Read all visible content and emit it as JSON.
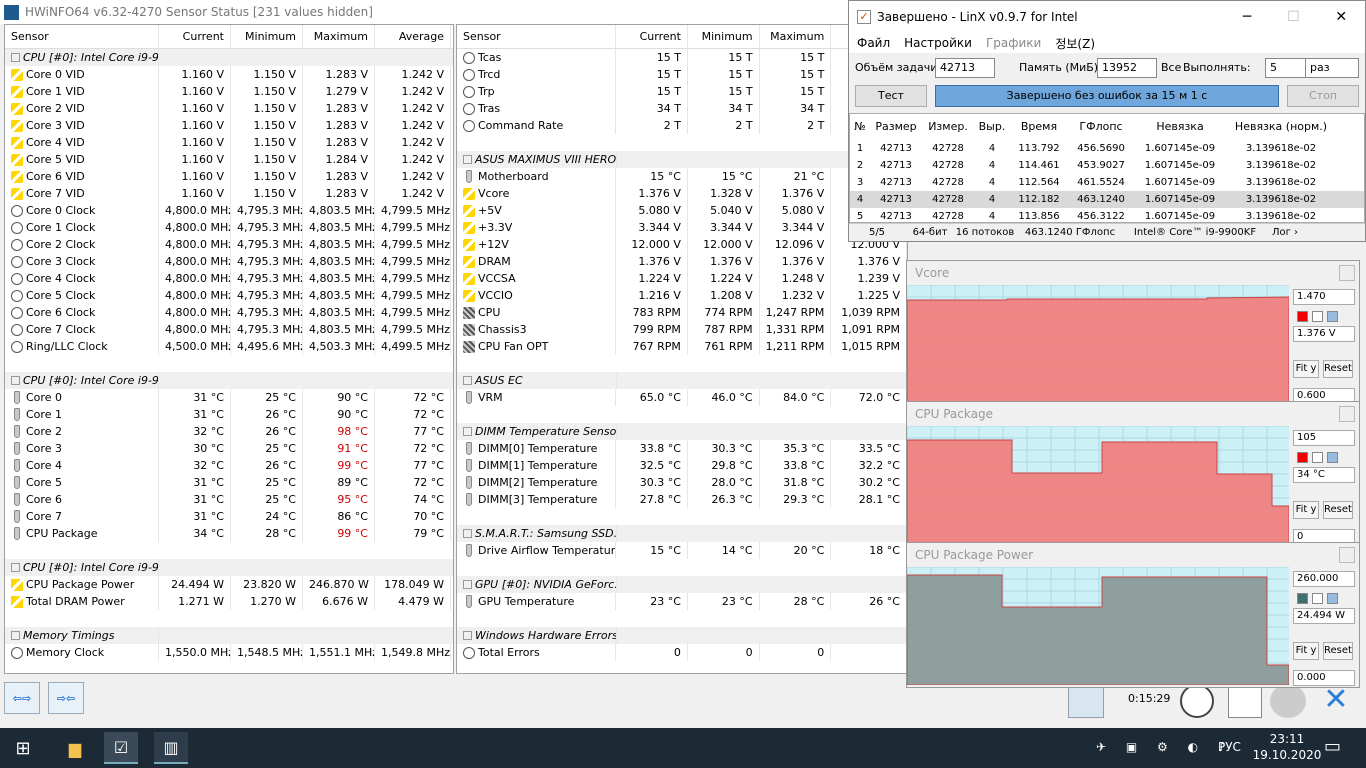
{
  "hwinfo": {
    "title": "HWiNFO64 v6.32-4270 Sensor Status [231 values hidden]",
    "headers": [
      "Sensor",
      "Current",
      "Minimum",
      "Maximum",
      "Average"
    ],
    "left": [
      {
        "t": "g",
        "n": "CPU [#0]: Intel Core i9-9..."
      },
      {
        "i": "volt",
        "n": "Core 0 VID",
        "c": "1.160 V",
        "mi": "1.150 V",
        "ma": "1.283 V",
        "a": "1.242 V"
      },
      {
        "i": "volt",
        "n": "Core 1 VID",
        "c": "1.160 V",
        "mi": "1.150 V",
        "ma": "1.279 V",
        "a": "1.242 V"
      },
      {
        "i": "volt",
        "n": "Core 2 VID",
        "c": "1.160 V",
        "mi": "1.150 V",
        "ma": "1.283 V",
        "a": "1.242 V"
      },
      {
        "i": "volt",
        "n": "Core 3 VID",
        "c": "1.160 V",
        "mi": "1.150 V",
        "ma": "1.283 V",
        "a": "1.242 V"
      },
      {
        "i": "volt",
        "n": "Core 4 VID",
        "c": "1.160 V",
        "mi": "1.150 V",
        "ma": "1.283 V",
        "a": "1.242 V"
      },
      {
        "i": "volt",
        "n": "Core 5 VID",
        "c": "1.160 V",
        "mi": "1.150 V",
        "ma": "1.284 V",
        "a": "1.242 V"
      },
      {
        "i": "volt",
        "n": "Core 6 VID",
        "c": "1.160 V",
        "mi": "1.150 V",
        "ma": "1.283 V",
        "a": "1.242 V"
      },
      {
        "i": "volt",
        "n": "Core 7 VID",
        "c": "1.160 V",
        "mi": "1.150 V",
        "ma": "1.283 V",
        "a": "1.242 V"
      },
      {
        "i": "clock",
        "n": "Core 0 Clock",
        "c": "4,800.0 MHz",
        "mi": "4,795.3 MHz",
        "ma": "4,803.5 MHz",
        "a": "4,799.5 MHz"
      },
      {
        "i": "clock",
        "n": "Core 1 Clock",
        "c": "4,800.0 MHz",
        "mi": "4,795.3 MHz",
        "ma": "4,803.5 MHz",
        "a": "4,799.5 MHz"
      },
      {
        "i": "clock",
        "n": "Core 2 Clock",
        "c": "4,800.0 MHz",
        "mi": "4,795.3 MHz",
        "ma": "4,803.5 MHz",
        "a": "4,799.5 MHz"
      },
      {
        "i": "clock",
        "n": "Core 3 Clock",
        "c": "4,800.0 MHz",
        "mi": "4,795.3 MHz",
        "ma": "4,803.5 MHz",
        "a": "4,799.5 MHz"
      },
      {
        "i": "clock",
        "n": "Core 4 Clock",
        "c": "4,800.0 MHz",
        "mi": "4,795.3 MHz",
        "ma": "4,803.5 MHz",
        "a": "4,799.5 MHz"
      },
      {
        "i": "clock",
        "n": "Core 5 Clock",
        "c": "4,800.0 MHz",
        "mi": "4,795.3 MHz",
        "ma": "4,803.5 MHz",
        "a": "4,799.5 MHz"
      },
      {
        "i": "clock",
        "n": "Core 6 Clock",
        "c": "4,800.0 MHz",
        "mi": "4,795.3 MHz",
        "ma": "4,803.5 MHz",
        "a": "4,799.5 MHz"
      },
      {
        "i": "clock",
        "n": "Core 7 Clock",
        "c": "4,800.0 MHz",
        "mi": "4,795.3 MHz",
        "ma": "4,803.5 MHz",
        "a": "4,799.5 MHz"
      },
      {
        "i": "clock",
        "n": "Ring/LLC Clock",
        "c": "4,500.0 MHz",
        "mi": "4,495.6 MHz",
        "ma": "4,503.3 MHz",
        "a": "4,499.5 MHz"
      },
      {
        "t": "b"
      },
      {
        "t": "g",
        "n": "CPU [#0]: Intel Core i9-9..."
      },
      {
        "i": "temp",
        "n": "Core 0",
        "c": "31 °C",
        "mi": "25 °C",
        "ma": "90 °C",
        "a": "72 °C"
      },
      {
        "i": "temp",
        "n": "Core 1",
        "c": "31 °C",
        "mi": "26 °C",
        "ma": "90 °C",
        "a": "72 °C"
      },
      {
        "i": "temp",
        "n": "Core 2",
        "c": "32 °C",
        "mi": "26 °C",
        "ma": "98 °C",
        "a": "77 °C",
        "r": 1
      },
      {
        "i": "temp",
        "n": "Core 3",
        "c": "30 °C",
        "mi": "25 °C",
        "ma": "91 °C",
        "a": "72 °C",
        "r": 1
      },
      {
        "i": "temp",
        "n": "Core 4",
        "c": "32 °C",
        "mi": "26 °C",
        "ma": "99 °C",
        "a": "77 °C",
        "r": 1
      },
      {
        "i": "temp",
        "n": "Core 5",
        "c": "31 °C",
        "mi": "25 °C",
        "ma": "89 °C",
        "a": "72 °C"
      },
      {
        "i": "temp",
        "n": "Core 6",
        "c": "31 °C",
        "mi": "25 °C",
        "ma": "95 °C",
        "a": "74 °C",
        "r": 1
      },
      {
        "i": "temp",
        "n": "Core 7",
        "c": "31 °C",
        "mi": "24 °C",
        "ma": "86 °C",
        "a": "70 °C"
      },
      {
        "i": "temp",
        "n": "CPU Package",
        "c": "34 °C",
        "mi": "28 °C",
        "ma": "99 °C",
        "a": "79 °C",
        "r": 1
      },
      {
        "t": "b"
      },
      {
        "t": "g",
        "n": "CPU [#0]: Intel Core i9-9..."
      },
      {
        "i": "pow",
        "n": "CPU Package Power",
        "c": "24.494 W",
        "mi": "23.820 W",
        "ma": "246.870 W",
        "a": "178.049 W"
      },
      {
        "i": "pow",
        "n": "Total DRAM Power",
        "c": "1.271 W",
        "mi": "1.270 W",
        "ma": "6.676 W",
        "a": "4.479 W"
      },
      {
        "t": "b"
      },
      {
        "t": "g",
        "n": "Memory Timings"
      },
      {
        "i": "clock",
        "n": "Memory Clock",
        "c": "1,550.0 MHz",
        "mi": "1,548.5 MHz",
        "ma": "1,551.1 MHz",
        "a": "1,549.8 MHz"
      }
    ],
    "right": [
      {
        "i": "clock",
        "n": "Tcas",
        "c": "15 T",
        "mi": "15 T",
        "ma": "15 T",
        "a": ""
      },
      {
        "i": "clock",
        "n": "Trcd",
        "c": "15 T",
        "mi": "15 T",
        "ma": "15 T",
        "a": ""
      },
      {
        "i": "clock",
        "n": "Trp",
        "c": "15 T",
        "mi": "15 T",
        "ma": "15 T",
        "a": ""
      },
      {
        "i": "clock",
        "n": "Tras",
        "c": "34 T",
        "mi": "34 T",
        "ma": "34 T",
        "a": ""
      },
      {
        "i": "clock",
        "n": "Command Rate",
        "c": "2 T",
        "mi": "2 T",
        "ma": "2 T",
        "a": ""
      },
      {
        "t": "b"
      },
      {
        "t": "g",
        "n": "ASUS MAXIMUS VIII HERO..."
      },
      {
        "i": "temp",
        "n": "Motherboard",
        "c": "15 °C",
        "mi": "15 °C",
        "ma": "21 °C",
        "a": ""
      },
      {
        "i": "volt",
        "n": "Vcore",
        "c": "1.376 V",
        "mi": "1.328 V",
        "ma": "1.376 V",
        "a": ""
      },
      {
        "i": "volt",
        "n": "+5V",
        "c": "5.080 V",
        "mi": "5.040 V",
        "ma": "5.080 V",
        "a": ""
      },
      {
        "i": "volt",
        "n": "+3.3V",
        "c": "3.344 V",
        "mi": "3.344 V",
        "ma": "3.344 V",
        "a": ""
      },
      {
        "i": "volt",
        "n": "+12V",
        "c": "12.000 V",
        "mi": "12.000 V",
        "ma": "12.096 V",
        "a": "12.000 V"
      },
      {
        "i": "volt",
        "n": "DRAM",
        "c": "1.376 V",
        "mi": "1.376 V",
        "ma": "1.376 V",
        "a": "1.376 V"
      },
      {
        "i": "volt",
        "n": "VCCSA",
        "c": "1.224 V",
        "mi": "1.224 V",
        "ma": "1.248 V",
        "a": "1.239 V"
      },
      {
        "i": "volt",
        "n": "VCCIO",
        "c": "1.216 V",
        "mi": "1.208 V",
        "ma": "1.232 V",
        "a": "1.225 V"
      },
      {
        "i": "fan",
        "n": "CPU",
        "c": "783 RPM",
        "mi": "774 RPM",
        "ma": "1,247 RPM",
        "a": "1,039 RPM"
      },
      {
        "i": "fan",
        "n": "Chassis3",
        "c": "799 RPM",
        "mi": "787 RPM",
        "ma": "1,331 RPM",
        "a": "1,091 RPM"
      },
      {
        "i": "fan",
        "n": "CPU Fan OPT",
        "c": "767 RPM",
        "mi": "761 RPM",
        "ma": "1,211 RPM",
        "a": "1,015 RPM"
      },
      {
        "t": "b"
      },
      {
        "t": "g",
        "n": "ASUS EC"
      },
      {
        "i": "temp",
        "n": "VRM",
        "c": "65.0 °C",
        "mi": "46.0 °C",
        "ma": "84.0 °C",
        "a": "72.0 °C"
      },
      {
        "t": "b"
      },
      {
        "t": "g",
        "n": "DIMM Temperature Sensor"
      },
      {
        "i": "temp",
        "n": "DIMM[0] Temperature",
        "c": "33.8 °C",
        "mi": "30.3 °C",
        "ma": "35.3 °C",
        "a": "33.5 °C"
      },
      {
        "i": "temp",
        "n": "DIMM[1] Temperature",
        "c": "32.5 °C",
        "mi": "29.8 °C",
        "ma": "33.8 °C",
        "a": "32.2 °C"
      },
      {
        "i": "temp",
        "n": "DIMM[2] Temperature",
        "c": "30.3 °C",
        "mi": "28.0 °C",
        "ma": "31.8 °C",
        "a": "30.2 °C"
      },
      {
        "i": "temp",
        "n": "DIMM[3] Temperature",
        "c": "27.8 °C",
        "mi": "26.3 °C",
        "ma": "29.3 °C",
        "a": "28.1 °C"
      },
      {
        "t": "b"
      },
      {
        "t": "g",
        "n": "S.M.A.R.T.: Samsung SSD..."
      },
      {
        "i": "temp",
        "n": "Drive Airflow Temperature",
        "c": "15 °C",
        "mi": "14 °C",
        "ma": "20 °C",
        "a": "18 °C"
      },
      {
        "t": "b"
      },
      {
        "t": "g",
        "n": "GPU [#0]: NVIDIA GeForc..."
      },
      {
        "i": "temp",
        "n": "GPU Temperature",
        "c": "23 °C",
        "mi": "23 °C",
        "ma": "28 °C",
        "a": "26 °C"
      },
      {
        "t": "b"
      },
      {
        "t": "g",
        "n": "Windows Hardware Errors..."
      },
      {
        "i": "clock",
        "n": "Total Errors",
        "c": "0",
        "mi": "0",
        "ma": "0",
        "a": ""
      }
    ],
    "timer": "0:15:29"
  },
  "linx": {
    "title": "Завершено - LinX v0.9.7 for Intel",
    "menu": [
      "Файл",
      "Настройки",
      "Графики",
      "정보(Z)"
    ],
    "size_label": "Объём задачи:",
    "size": "42713",
    "mem_label": "Память (МиБ):",
    "mem": "13952",
    "all": "Все",
    "run_label": "Выполнять:",
    "runs": "5",
    "unit": "раз",
    "test_btn": "Тест",
    "status": "Завершено без ошибок за 15 м 1 с",
    "stop_btn": "Стоп",
    "cols": [
      "№",
      "Размер",
      "Измер.",
      "Выр.",
      "Время",
      "ГФлопс",
      "Невязка",
      "Невязка (норм.)"
    ],
    "rows": [
      [
        "1",
        "42713",
        "42728",
        "4",
        "113.792",
        "456.5690",
        "1.607145e-09",
        "3.139618e-02"
      ],
      [
        "2",
        "42713",
        "42728",
        "4",
        "114.461",
        "453.9027",
        "1.607145e-09",
        "3.139618e-02"
      ],
      [
        "3",
        "42713",
        "42728",
        "4",
        "112.564",
        "461.5524",
        "1.607145e-09",
        "3.139618e-02"
      ],
      [
        "4",
        "42713",
        "42728",
        "4",
        "112.182",
        "463.1240",
        "1.607145e-09",
        "3.139618e-02"
      ],
      [
        "5",
        "42713",
        "42728",
        "4",
        "113.856",
        "456.3122",
        "1.607145e-09",
        "3.139618e-02"
      ]
    ],
    "statusbar": [
      "5/5",
      "64-бит",
      "16 потоков",
      "463.1240 ГФлопс пик",
      "Intel® Core™ i9-9900KF",
      "Лог ›"
    ]
  },
  "graphs": [
    {
      "title": "Vcore",
      "max": "1.470",
      "cur": "1.376 V",
      "min": "0.600",
      "color": "#f08080"
    },
    {
      "title": "CPU Package",
      "max": "105",
      "cur": "34 °C",
      "min": "0",
      "color": "#f08080"
    },
    {
      "title": "CPU Package Power",
      "max": "260.000",
      "cur": "24.494 W",
      "min": "0.000",
      "color": "#8a9a98"
    }
  ],
  "graph_btns": {
    "fit": "Fit y",
    "reset": "Reset"
  },
  "taskbar": {
    "lang": "РУС",
    "time": "23:11",
    "date": "19.10.2020"
  }
}
